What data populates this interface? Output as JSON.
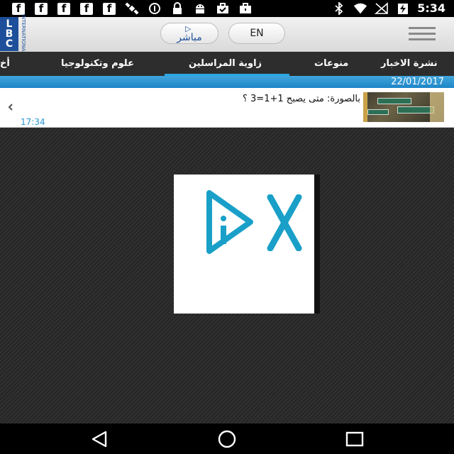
{
  "status_bar": {
    "time": "5:34",
    "left_icons": [
      "facebook-icon",
      "facebook-icon",
      "facebook-icon",
      "facebook-icon",
      "facebook-icon",
      "satellite-icon",
      "circle-icon",
      "lock-icon",
      "android-icon",
      "briefcase-icon",
      "briefcase-icon"
    ],
    "right_icons": [
      "bluetooth-icon",
      "wifi-icon",
      "signal-icon",
      "battery-charging-icon"
    ]
  },
  "header": {
    "logo_letters": "LBC",
    "logo_sub": "INTERNATIONAL",
    "live_label": "مباشر",
    "lang_label": "EN"
  },
  "tabs": {
    "items": [
      {
        "label": "أخ"
      },
      {
        "label": "علوم وتكنولوجيا"
      },
      {
        "label": "زاوية المراسلين",
        "active": true
      },
      {
        "label": "منوعات"
      },
      {
        "label": "نشرة الاخبار"
      }
    ],
    "accent": "#29a8e0"
  },
  "date_bar": {
    "date": "22/01/2017"
  },
  "news_item": {
    "title": "بالصورة: متى يصبح 1+1=3 ؟",
    "time": "17:34"
  },
  "colors": {
    "brand": "#1d4f9a",
    "accent": "#29a8e0",
    "player_icon": "#1aa0c8"
  },
  "nav_bar": {
    "buttons": [
      "back-icon",
      "home-icon",
      "recents-icon"
    ]
  }
}
